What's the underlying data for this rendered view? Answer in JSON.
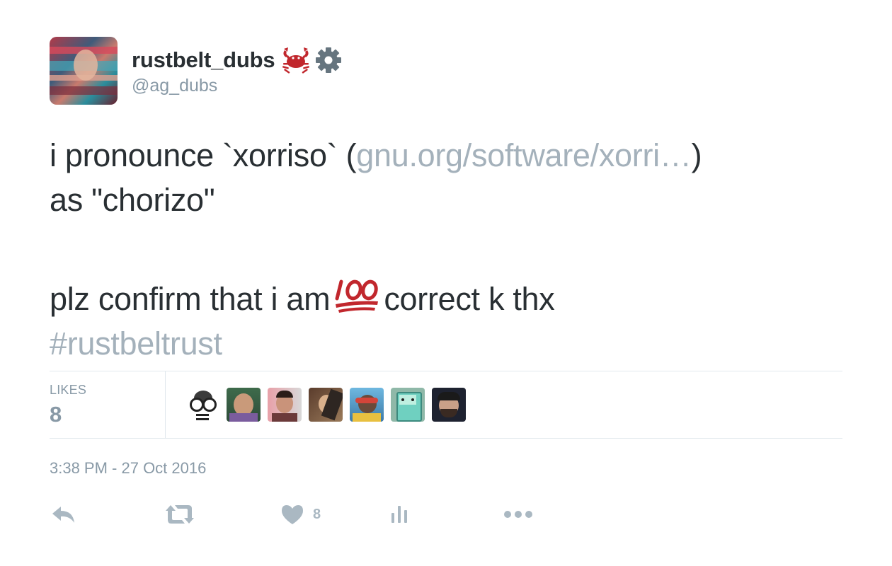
{
  "user": {
    "display_name": "rustbelt_dubs",
    "handle": "@ag_dubs",
    "badges": [
      "crab-emoji",
      "gear-emoji"
    ]
  },
  "tweet": {
    "line1_prefix": "i pronounce `xorriso` (",
    "link_text": "gnu.org/software/xorri…",
    "line1_suffix": ")",
    "line2": "as \"chorizo\"",
    "line3_prefix": "plz confirm that i am",
    "emoji": "hundred-points-emoji",
    "line3_suffix": "correct k thx",
    "hashtag": "#rustbeltrust"
  },
  "stats": {
    "likes_label": "LIKES",
    "likes_count": "8",
    "likers": [
      "liker-1",
      "liker-2",
      "liker-3",
      "liker-4",
      "liker-5",
      "liker-6",
      "liker-7"
    ]
  },
  "timestamp": "3:38 PM - 27 Oct 2016",
  "actions": {
    "reply_icon": "reply-icon",
    "retweet_icon": "retweet-icon",
    "like_icon": "heart-icon",
    "like_count": "8",
    "analytics_icon": "analytics-icon",
    "more_icon": "more-icon"
  },
  "colors": {
    "text": "#292f33",
    "muted": "#8899a6",
    "link": "#a4b1bb",
    "border": "#e1e8ed",
    "icon": "#aab8c2",
    "emoji_red": "#c1272d"
  }
}
